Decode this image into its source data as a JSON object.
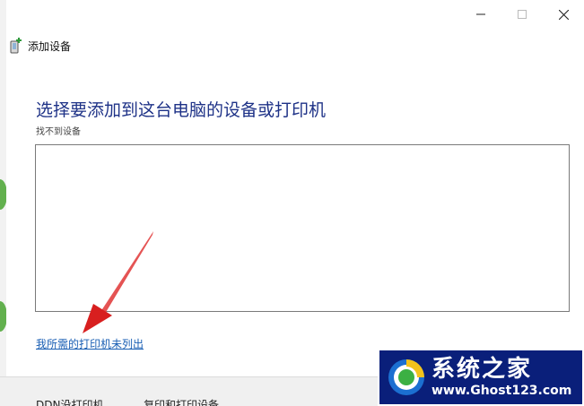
{
  "window": {
    "title": "添加设备",
    "title_icon": "add-device-icon",
    "controls": [
      "minimize-icon",
      "maximize-icon",
      "close-icon"
    ]
  },
  "main": {
    "heading": "选择要添加到这台电脑的设备或打印机",
    "status": "找不到设备",
    "device_list": [],
    "printer_not_listed_link": "我所需的打印机未列出"
  },
  "bottom_bar": {
    "partial_text_1": "DDN没打印机",
    "partial_text_2": "复印和打印设备"
  },
  "watermark": {
    "title": "系统之家",
    "url": "www.Ghost123.com"
  },
  "colors": {
    "heading": "#1e3287",
    "link": "#1a5fb4",
    "watermark_bg": "#0a1f7a",
    "arrow": "#e02020"
  }
}
